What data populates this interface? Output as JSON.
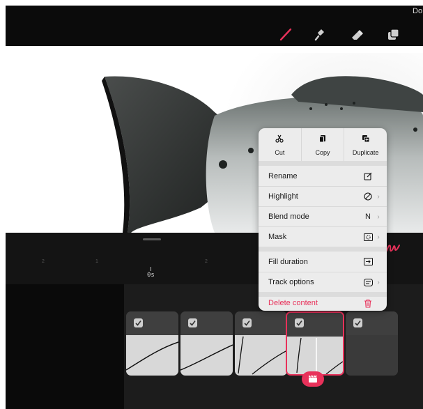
{
  "header": {
    "done_label": "Do"
  },
  "timeline": {
    "ruler_labels": [
      "2",
      "1",
      "2"
    ],
    "playhead_label": "0s"
  },
  "menu": {
    "quick_actions": [
      {
        "label": "Cut",
        "icon": "scissors-icon"
      },
      {
        "label": "Copy",
        "icon": "copy-icon"
      },
      {
        "label": "Duplicate",
        "icon": "duplicate-icon"
      }
    ],
    "items": [
      {
        "label": "Rename",
        "value": "",
        "icon": "rename-icon",
        "chevron": false
      },
      {
        "label": "Highlight",
        "value": "",
        "icon": "highlight-icon",
        "chevron": true
      },
      {
        "label": "Blend mode",
        "value": "N",
        "icon": "",
        "chevron": true
      },
      {
        "label": "Mask",
        "value": "",
        "icon": "mask-icon",
        "chevron": true
      },
      {
        "label": "Fill duration",
        "value": "",
        "icon": "fill-duration-icon",
        "chevron": false
      },
      {
        "label": "Track options",
        "value": "",
        "icon": "track-options-icon",
        "chevron": true
      }
    ],
    "delete_label": "Delete content"
  },
  "colors": {
    "accent": "#e8315a",
    "toolbar_bg": "#0b0b0b",
    "timeline_bg": "#141414",
    "menu_bg": "#ececec"
  }
}
